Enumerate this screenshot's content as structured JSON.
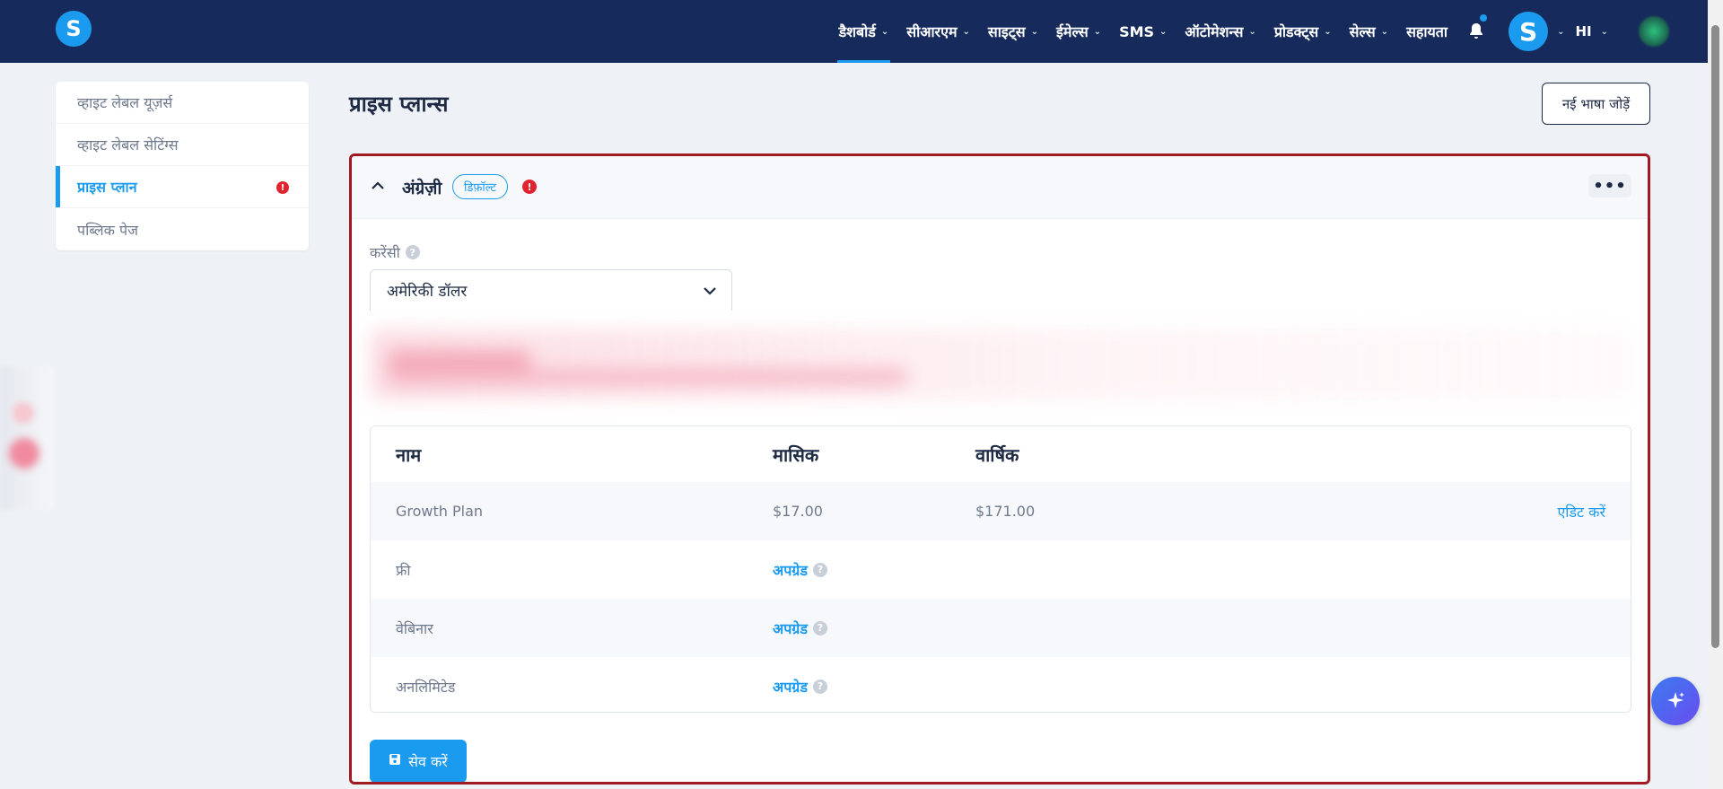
{
  "colors": {
    "nav_bg": "#162b5c",
    "accent": "#1b9bef",
    "danger": "#e0232e",
    "highlight_border": "#a11922"
  },
  "topnav": {
    "logo": "S",
    "items": [
      {
        "label": "डैशबोर्ड",
        "active": true
      },
      {
        "label": "सीआरएम"
      },
      {
        "label": "साइट्स"
      },
      {
        "label": "ईमेल्स"
      },
      {
        "label": "SMS"
      },
      {
        "label": "ऑटोमेशन्स"
      },
      {
        "label": "प्रोडक्ट्स"
      },
      {
        "label": "सेल्स"
      },
      {
        "label": "सहायता"
      }
    ],
    "avatar_letter": "S",
    "language": "HI"
  },
  "sidebar": {
    "items": [
      {
        "label": "व्हाइट लेबल यूज़र्स"
      },
      {
        "label": "व्हाइट लेबल सेटिंग्स"
      },
      {
        "label": "प्राइस प्लान",
        "active": true,
        "error": "!"
      },
      {
        "label": "पब्लिक पेज"
      }
    ]
  },
  "page": {
    "title": "प्राइस प्लान्स",
    "add_language_button": "नई भाषा जोड़ें"
  },
  "language_card": {
    "language": "अंग्रेज़ी",
    "badge": "डिफ़ॉल्ट",
    "error": "!",
    "more": "•••",
    "currency_label": "करेंसी",
    "currency_help": "?",
    "currency_value": "अमेरिकी डॉलर",
    "table": {
      "headers": [
        "नाम",
        "मासिक",
        "वार्षिक"
      ],
      "rows": [
        {
          "name": "Growth Plan",
          "monthly": "$17.00",
          "yearly": "$171.00",
          "action": "एडिट करें"
        },
        {
          "name": "फ्री",
          "upgrade": "अपग्रेड"
        },
        {
          "name": "वेबिनार",
          "upgrade": "अपग्रेड"
        },
        {
          "name": "अनलिमिटेड",
          "upgrade": "अपग्रेड"
        }
      ]
    },
    "save_button": "सेव करें"
  }
}
